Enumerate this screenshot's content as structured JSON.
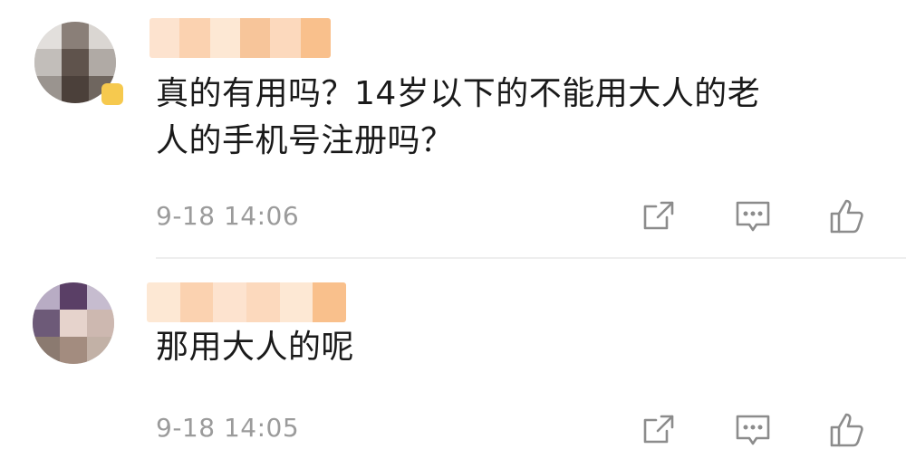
{
  "comments": [
    {
      "text_line1": "真的有用吗？14岁以下的不能用大人的老",
      "text_line2": "人的手机号注册吗？",
      "time": "9-18 14:06",
      "actions": [
        "share-icon",
        "reply-icon",
        "like-icon"
      ]
    },
    {
      "text_line1": "那用大人的呢",
      "time": "9-18 14:05",
      "actions": [
        "share-icon",
        "reply-icon",
        "like-icon"
      ]
    }
  ],
  "colors": {
    "text": "#1a1a1a",
    "meta": "#9b9b9b",
    "icon": "#8c8c8c",
    "divider": "#eeeeee",
    "username_blur": [
      "#fde3cf",
      "#fbd2b0",
      "#f7c59a",
      "#fde8d4"
    ]
  }
}
